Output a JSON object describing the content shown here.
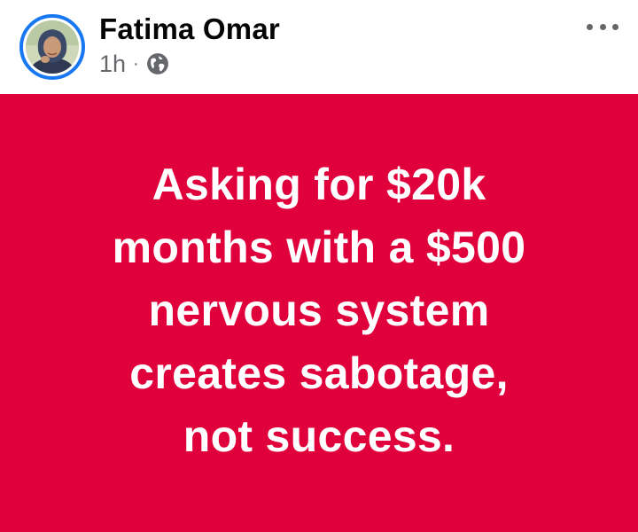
{
  "author": {
    "name": "Fatima Omar",
    "avatar_icon": "profile-photo"
  },
  "meta": {
    "time": "1h",
    "separator": "·",
    "audience_icon": "globe-icon"
  },
  "post": {
    "lines": [
      "Asking for $20k",
      "months with a $500",
      "nervous system",
      "creates sabotage,",
      "not success."
    ],
    "background_color": "#e0003c",
    "text_color": "#ffffff"
  },
  "colors": {
    "avatar_ring": "#1877f2",
    "meta_text": "#65676b"
  },
  "menu": {
    "more_icon": "more-options-icon"
  }
}
